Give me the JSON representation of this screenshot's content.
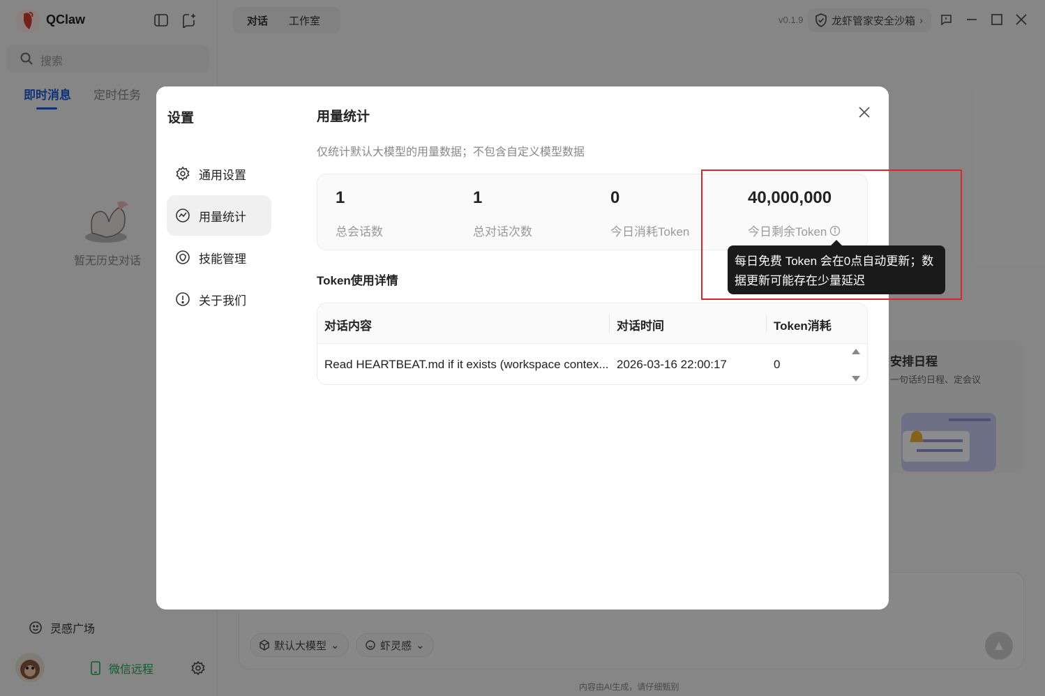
{
  "app": {
    "name": "QClaw",
    "search_placeholder": "搜索",
    "side_tabs": [
      "即时消息",
      "定时任务"
    ],
    "empty_text": "暂无历史对话",
    "inspiration": "灵感广场",
    "wechat_remote": "微信远程",
    "mode_tabs": [
      "对话",
      "工作室"
    ],
    "version": "v0.1.9",
    "sandbox": "龙虾管家安全沙箱",
    "card_title": "安排日程",
    "card_sub": "一句话约日程、定会议",
    "chip_model": "默认大模型",
    "chip_inspire": "虾灵感",
    "disclaimer": "内容由AI生成，请仔细甄别"
  },
  "settings": {
    "title": "设置",
    "nav": [
      "通用设置",
      "用量统计",
      "技能管理",
      "关于我们"
    ],
    "active_nav": "用量统计",
    "section_title": "用量统计",
    "description": "仅统计默认大模型的用量数据；不包含自定义模型数据",
    "stats": [
      {
        "value": "1",
        "label": "总会话数"
      },
      {
        "value": "1",
        "label": "总对话次数"
      },
      {
        "value": "0",
        "label": "今日消耗Token"
      },
      {
        "value": "40,000,000",
        "label": "今日剩余Token"
      }
    ],
    "detail_title": "Token使用详情",
    "table": {
      "headers": [
        "对话内容",
        "对话时间",
        "Token消耗"
      ],
      "rows": [
        [
          "Read HEARTBEAT.md if it exists (workspace contex...",
          "2026-03-16 22:00:17",
          "0"
        ]
      ]
    },
    "tooltip_lines": [
      "每日免费 Token 会在0点自动更新；数",
      "据更新可能存在少量延迟"
    ]
  },
  "colors": {
    "accent": "#1e5bd6",
    "wechat": "#1aaa55",
    "highlight": "#e0242b"
  }
}
